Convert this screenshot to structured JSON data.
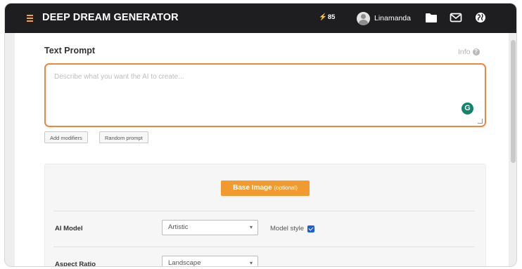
{
  "header": {
    "brand": "DEEP DREAM GENERATOR",
    "energy": "85",
    "username": "Linamanda",
    "icons": [
      "menu-icon",
      "bolt-icon",
      "avatar",
      "folder-icon",
      "mail-icon",
      "globe-icon"
    ]
  },
  "prompt_section": {
    "title": "Text Prompt",
    "info_label": "Info",
    "placeholder": "Describe what you want the AI to create...",
    "add_modifiers_label": "Add modifiers",
    "random_prompt_label": "Random prompt"
  },
  "settings": {
    "base_image_label": "Base Image",
    "base_image_optional": "(optional)",
    "ai_model_label": "AI Model",
    "ai_model_value": "Artistic",
    "model_style_label": "Model style",
    "model_style_checked": true,
    "aspect_ratio_label": "Aspect Ratio",
    "aspect_ratio_value": "Landscape"
  },
  "colors": {
    "topbar": "#1e1e20",
    "accent_orange": "#f19a30",
    "prompt_border": "#f0853e",
    "grammarly_green": "#11846b",
    "checkbox_blue": "#1a5fd6"
  }
}
